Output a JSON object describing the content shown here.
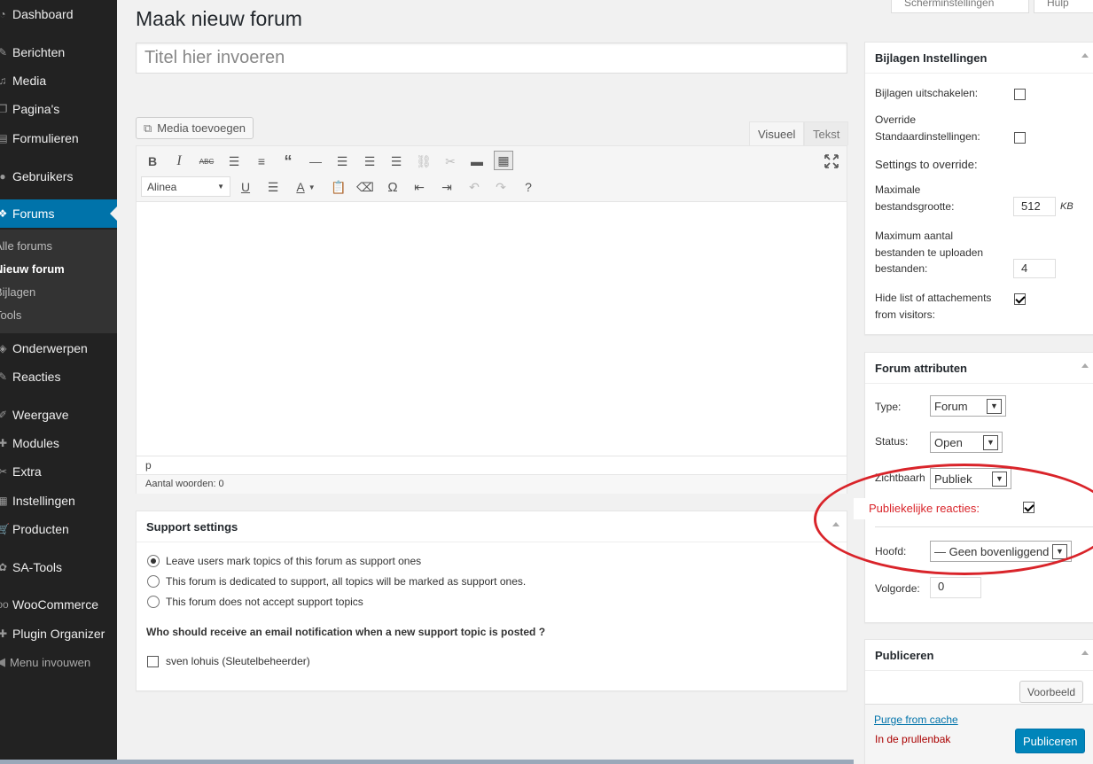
{
  "sidebar": {
    "items": [
      {
        "label": "Dashboard",
        "icon": "dashboard-icon",
        "glyph": "◔"
      },
      {
        "label": "Berichten",
        "icon": "pin-icon",
        "glyph": "✎"
      },
      {
        "label": "Media",
        "icon": "media-icon",
        "glyph": "♫"
      },
      {
        "label": "Pagina's",
        "icon": "pages-icon",
        "glyph": "❐"
      },
      {
        "label": "Formulieren",
        "icon": "forms-icon",
        "glyph": "▤"
      },
      {
        "label": "Gebruikers",
        "icon": "users-icon",
        "glyph": "●"
      },
      {
        "label": "Forums",
        "icon": "forums-icon",
        "glyph": "❖"
      },
      {
        "label": "Onderwerpen",
        "icon": "topics-icon",
        "glyph": "◈"
      },
      {
        "label": "Reacties",
        "icon": "replies-icon",
        "glyph": "✎"
      },
      {
        "label": "Weergave",
        "icon": "appearance-icon",
        "glyph": "✐"
      },
      {
        "label": "Modules",
        "icon": "plugins-icon",
        "glyph": "✚"
      },
      {
        "label": "Extra",
        "icon": "tools-icon",
        "glyph": "✂"
      },
      {
        "label": "Instellingen",
        "icon": "settings-icon",
        "glyph": "▦"
      },
      {
        "label": "Producten",
        "icon": "products-icon",
        "glyph": "🛒"
      },
      {
        "label": "SA-Tools",
        "icon": "sa-tools-icon",
        "glyph": "✿"
      },
      {
        "label": "WooCommerce",
        "icon": "woocommerce-icon",
        "glyph": "oo"
      },
      {
        "label": "Plugin Organizer",
        "icon": "plugin-organizer-icon",
        "glyph": "✚"
      }
    ],
    "submenu": [
      "Alle forums",
      "Nieuw forum",
      "Bijlagen",
      "Tools"
    ],
    "collapse_label": "Menu invouwen"
  },
  "top_buttons": {
    "screen_options": "Scherminstellingen",
    "help": "Hulp"
  },
  "page_title": "Maak nieuw forum",
  "title_placeholder": "Titel hier invoeren",
  "editor": {
    "media_button": "Media toevoegen",
    "tab_visual": "Visueel",
    "tab_text": "Tekst",
    "format_select": "Alinea",
    "path": "p",
    "word_count": "Aantal woorden: 0"
  },
  "support_settings": {
    "title": "Support settings",
    "options": [
      "Leave users mark topics of this forum as support ones",
      "This forum is dedicated to support, all topics will be marked as support ones.",
      "This forum does not accept support topics"
    ],
    "selected_index": 0,
    "notify_question": "Who should receive an email notification when a new support topic is posted ?",
    "notify_user": "sven lohuis (Sleutelbeheerder)"
  },
  "bijlagen": {
    "title": "Bijlagen Instellingen",
    "disable_label": "Bijlagen uitschakelen:",
    "override_label_1": "Override",
    "override_label_2": "Standaardinstellingen:",
    "settings_override": "Settings to override:",
    "max_size_label_1": "Maximale",
    "max_size_label_2": "bestandsgrootte:",
    "max_size_value": "512",
    "max_size_unit": "KB",
    "max_files_label_1": "Maximum aantal",
    "max_files_label_2": "bestanden te uploaden",
    "max_files_label_3": "bestanden:",
    "max_files_value": "4",
    "hide_label_1": "Hide list of attachements",
    "hide_label_2": "from visitors:"
  },
  "forum_attributes": {
    "title": "Forum attributen",
    "type_label": "Type:",
    "type_value": "Forum",
    "status_label": "Status:",
    "status_value": "Open",
    "visibility_label": "Zichtbaarh",
    "visibility_value": "Publiek",
    "public_replies_label": "Publiekelijke reacties:",
    "parent_label": "Hoofd:",
    "parent_value": "— Geen bovenliggend",
    "order_label": "Volgorde:",
    "order_value": "0"
  },
  "publish": {
    "title": "Publiceren",
    "preview": "Voorbeeld",
    "purge": "Purge from cache",
    "trash": "In de prullenbak",
    "publish_button": "Publiceren"
  },
  "colors": {
    "accent": "#0073aa",
    "annotation": "#d9242a",
    "trash": "#a00"
  }
}
